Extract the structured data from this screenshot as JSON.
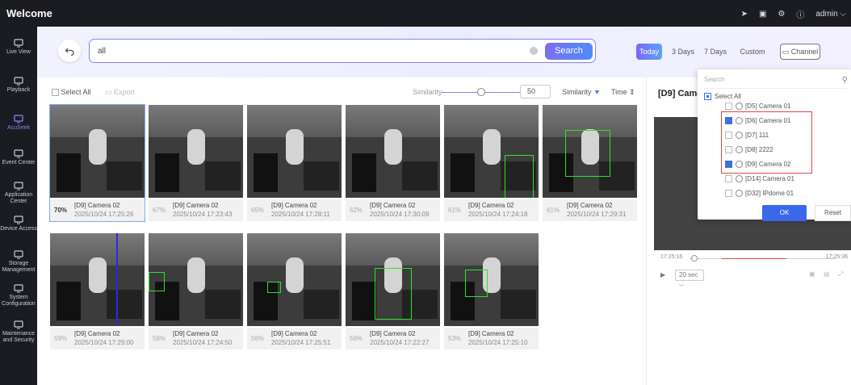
{
  "app": {
    "title": "Welcome",
    "user": "admin"
  },
  "sidebar": [
    {
      "label": "Live View",
      "icon": "monitor-icon"
    },
    {
      "label": "Playback",
      "icon": "playback-icon"
    },
    {
      "label": "AcuSeek",
      "icon": "acuseek-icon"
    },
    {
      "label": "Event Center",
      "icon": "event-icon"
    },
    {
      "label": "Application Center",
      "icon": "app-center-icon"
    },
    {
      "label": "Device Access",
      "icon": "device-icon"
    },
    {
      "label": "Storage Management",
      "icon": "storage-icon"
    },
    {
      "label": "System Configuration",
      "icon": "system-icon"
    },
    {
      "label": "Maintenance and Security",
      "icon": "maintenance-icon"
    }
  ],
  "search": {
    "value": "all",
    "button": "Search"
  },
  "ranges": [
    "Today",
    "3 Days",
    "7 Days",
    "Custom"
  ],
  "channel_label": "Channel",
  "toolbar": {
    "select_all": "Select All",
    "export": "Export",
    "similarity": "Similarity",
    "threshold": "50",
    "sort_similarity": "Similarity",
    "sort_time": "Time"
  },
  "results": [
    {
      "pct": "70%",
      "cam": "[D9] Camera 02",
      "time": "2025/10/24 17:25:26"
    },
    {
      "pct": "67%",
      "cam": "[D9] Camera 02",
      "time": "2025/10/24 17:23:43"
    },
    {
      "pct": "65%",
      "cam": "[D9] Camera 02",
      "time": "2025/10/24 17:28:11"
    },
    {
      "pct": "62%",
      "cam": "[D9] Camera 02",
      "time": "2025/10/24 17:30:09"
    },
    {
      "pct": "61%",
      "cam": "[D9] Camera 02",
      "time": "2025/10/24 17:24:18"
    },
    {
      "pct": "61%",
      "cam": "[D9] Camera 02",
      "time": "2025/10/24 17:29:31"
    },
    {
      "pct": "59%",
      "cam": "[D9] Camera 02",
      "time": "2025/10/24 17:29:00"
    },
    {
      "pct": "58%",
      "cam": "[D9] Camera 02",
      "time": "2025/10/24 17:24:50"
    },
    {
      "pct": "56%",
      "cam": "[D9] Camera 02",
      "time": "2025/10/24 17:25:51"
    },
    {
      "pct": "56%",
      "cam": "[D9] Camera 02",
      "time": "2025/10/24 17:22:27"
    },
    {
      "pct": "53%",
      "cam": "[D9] Camera 02",
      "time": "2025/10/24 17:25:10"
    }
  ],
  "detail": {
    "title": "[D9] Came",
    "time_start": "17:25:16",
    "time_end": "17:25:36",
    "interval": "20 sec"
  },
  "dropdown": {
    "search_placeholder": "Search",
    "select_all": "Select All",
    "options": [
      {
        "label": "[D5] Camera 01",
        "checked": false
      },
      {
        "label": "[D6] Camera 01",
        "checked": true
      },
      {
        "label": "[D7] 111",
        "checked": false
      },
      {
        "label": "[D8] 2222",
        "checked": false
      },
      {
        "label": "[D9] Camera 02",
        "checked": true
      },
      {
        "label": "[D14] Camera 01",
        "checked": false
      },
      {
        "label": "[D32] IPdome 01",
        "checked": false
      }
    ],
    "ok": "OK",
    "reset": "Reset"
  },
  "colors": {
    "accent": "#7b6ff0",
    "highlight": "#e04848",
    "bbox": "#2ee02e"
  }
}
